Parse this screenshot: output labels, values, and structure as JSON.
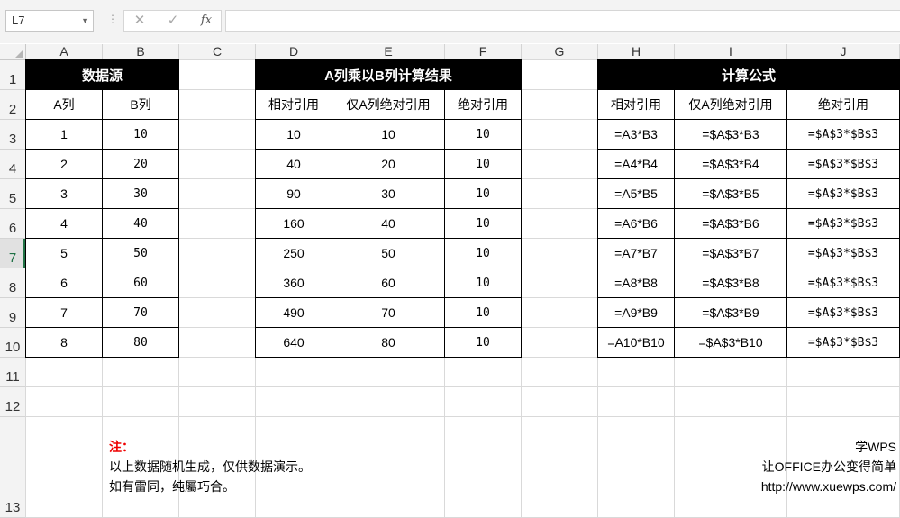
{
  "name_box": "L7",
  "formula_buttons": {
    "cancel": "✕",
    "confirm": "✓",
    "fx": "fx"
  },
  "formula_value": "",
  "columns": [
    "A",
    "B",
    "C",
    "D",
    "E",
    "F",
    "G",
    "H",
    "I",
    "J"
  ],
  "rows": [
    "1",
    "2",
    "3",
    "4",
    "5",
    "6",
    "7",
    "8",
    "9",
    "10",
    "11",
    "12",
    "13"
  ],
  "active_row": "7",
  "source": {
    "title": "数据源",
    "col_a": "A列",
    "col_b": "B列",
    "a_values": [
      "1",
      "2",
      "3",
      "4",
      "5",
      "6",
      "7",
      "8"
    ],
    "b_values": [
      "10",
      "20",
      "30",
      "40",
      "50",
      "60",
      "70",
      "80"
    ]
  },
  "results": {
    "title": "A列乘以B列计算结果",
    "col_rel": "相对引用",
    "col_mixed": "仅A列绝对引用",
    "col_abs": "绝对引用",
    "rel_values": [
      "10",
      "40",
      "90",
      "160",
      "250",
      "360",
      "490",
      "640"
    ],
    "mixed_values": [
      "10",
      "20",
      "30",
      "40",
      "50",
      "60",
      "70",
      "80"
    ],
    "abs_values": [
      "10",
      "10",
      "10",
      "10",
      "10",
      "10",
      "10",
      "10"
    ]
  },
  "formulas": {
    "title": "计算公式",
    "col_rel": "相对引用",
    "col_mixed": "仅A列绝对引用",
    "col_abs": "绝对引用",
    "rel": [
      "=A3*B3",
      "=A4*B4",
      "=A5*B5",
      "=A6*B6",
      "=A7*B7",
      "=A8*B8",
      "=A9*B9",
      "=A10*B10"
    ],
    "mixed": [
      "=$A$3*B3",
      "=$A$3*B4",
      "=$A$3*B5",
      "=$A$3*B6",
      "=$A$3*B7",
      "=$A$3*B8",
      "=$A$3*B9",
      "=$A$3*B10"
    ],
    "abs": [
      "=$A$3*$B$3",
      "=$A$3*$B$3",
      "=$A$3*$B$3",
      "=$A$3*$B$3",
      "=$A$3*$B$3",
      "=$A$3*$B$3",
      "=$A$3*$B$3",
      "=$A$3*$B$3"
    ]
  },
  "note": {
    "title": "注：",
    "line1": "以上数据随机生成，仅供数据演示。",
    "line2": "如有雷同，纯屬巧合。"
  },
  "brand": {
    "name": "学WPS",
    "slogan": "让OFFICE办公变得简单",
    "url": "http://www.xuewps.com/"
  }
}
